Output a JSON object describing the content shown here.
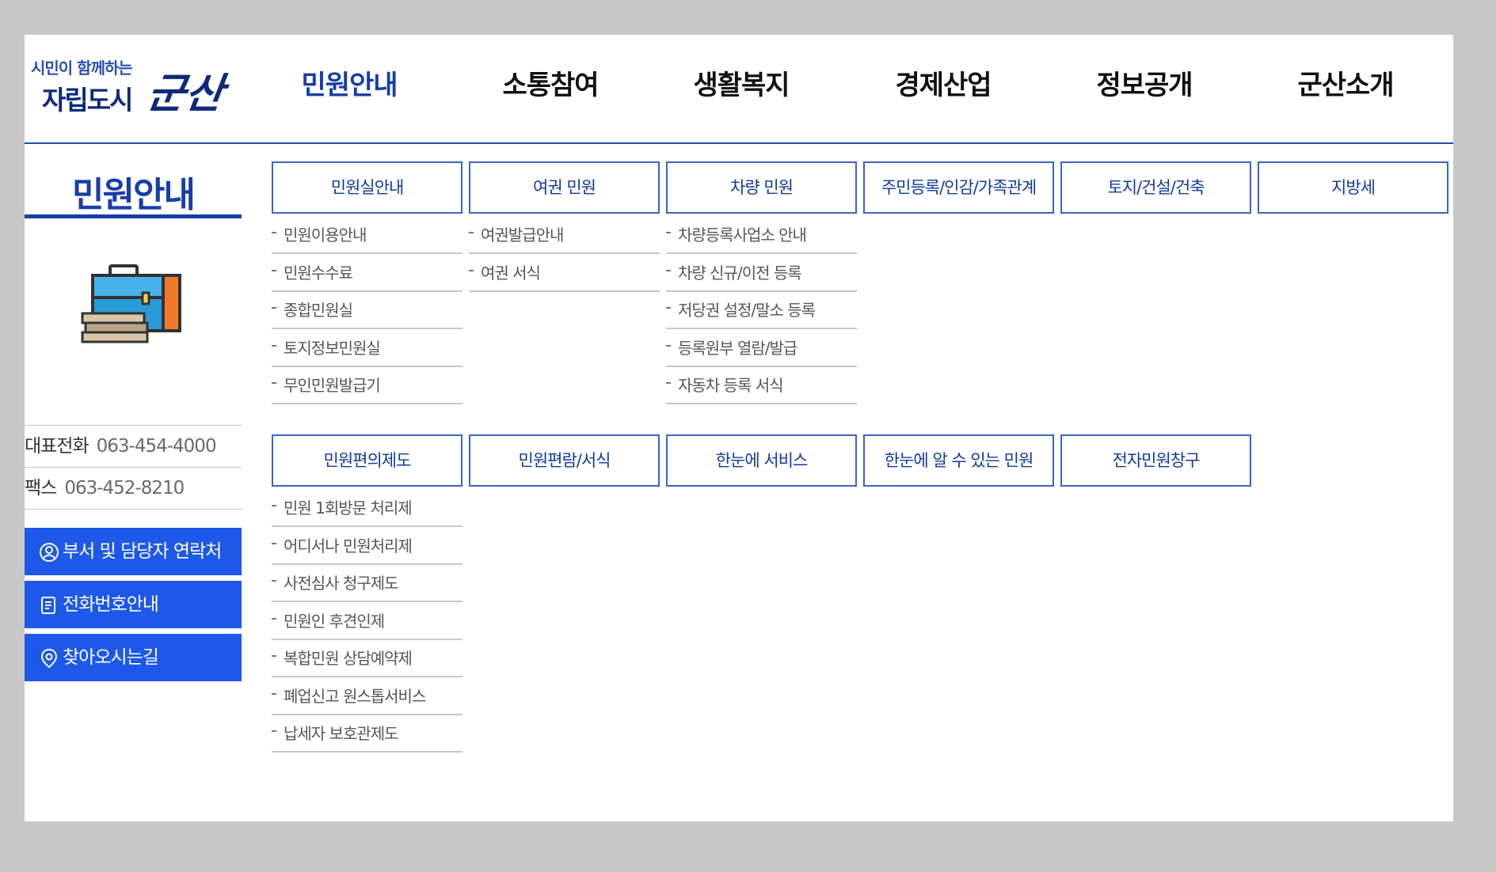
{
  "header": {
    "logo": {
      "slogan": "시민이 함께하는",
      "city_type": "자립도시",
      "city_name": "군산"
    },
    "gnb": [
      {
        "label": "민원안내",
        "active": true
      },
      {
        "label": "소통참여",
        "active": false
      },
      {
        "label": "생활복지",
        "active": false
      },
      {
        "label": "경제산업",
        "active": false
      },
      {
        "label": "정보공개",
        "active": false
      },
      {
        "label": "군산소개",
        "active": false
      }
    ]
  },
  "lnb": {
    "title": "민원안내",
    "icon": "briefcase-books-icon",
    "contacts": [
      {
        "label": "대표전화",
        "value": "063-454-4000"
      },
      {
        "label": "팩스",
        "value": "063-452-8210"
      }
    ],
    "quick_links": [
      {
        "label": "부서 및 담당자 연락처",
        "icon": "person-search-icon"
      },
      {
        "label": "전화번호안내",
        "icon": "document-list-icon"
      },
      {
        "label": "찾아오시는길",
        "icon": "location-pin-icon"
      }
    ]
  },
  "menu": {
    "row1": [
      {
        "title": "민원실안내",
        "items": [
          "민원이용안내",
          "민원수수료",
          "종합민원실",
          "토지정보민원실",
          "무인민원발급기"
        ]
      },
      {
        "title": "여권 민원",
        "items": [
          "여권발급안내",
          "여권 서식"
        ]
      },
      {
        "title": "차량 민원",
        "items": [
          "차량등록사업소 안내",
          "차량 신규/이전 등록",
          "저당권 설정/말소 등록",
          "등록원부 열람/발급",
          "자동차 등록 서식"
        ]
      },
      {
        "title": "주민등록/인감/가족관계",
        "items": []
      },
      {
        "title": "토지/건설/건축",
        "items": []
      },
      {
        "title": "지방세",
        "items": []
      }
    ],
    "row2": [
      {
        "title": "민원편의제도",
        "items": [
          "민원 1회방문 처리제",
          "어디서나 민원처리제",
          "사전심사 청구제도",
          "민원인 후견인제",
          "복합민원 상담예약제",
          "폐업신고 원스톱서비스",
          "납세자 보호관제도"
        ]
      },
      {
        "title": "민원편람/서식",
        "items": []
      },
      {
        "title": "한눈에 서비스",
        "items": []
      },
      {
        "title": "한눈에 알 수 있는 민원",
        "items": []
      },
      {
        "title": "전자민원창구",
        "items": []
      }
    ]
  },
  "colors": {
    "primary": "#173ea8",
    "button": "#1e58e8",
    "border": "#3d63c4",
    "backdrop": "#c8c8c8"
  }
}
